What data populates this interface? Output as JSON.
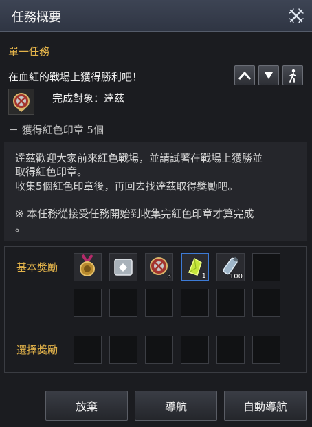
{
  "window": {
    "title": "任務概要"
  },
  "quest": {
    "type": "單一任務",
    "name": "在血紅的戰場上獲得勝利吧！",
    "target": "完成對象：達茲",
    "objective": "－ 獲得紅色印章 5個"
  },
  "description": {
    "lines": [
      "達茲歡迎大家前來紅色戰場，並請試著在戰場上獲勝並",
      "取得紅色印章。",
      "收集5個紅色印章後，再回去找達茲取得獎勵吧。",
      "",
      "※ 本任務從接受任務開始到收集完紅色印章才算完成",
      "。"
    ]
  },
  "rewards": {
    "basic_label": "基本獎勵",
    "choice_label": "選擇獎勵",
    "basic_items": [
      {
        "icon": "medal-icon",
        "qty": ""
      },
      {
        "icon": "scroll-icon",
        "qty": ""
      },
      {
        "icon": "red-seal-icon",
        "qty": "3"
      },
      {
        "icon": "crystal-icon",
        "qty": "1"
      },
      {
        "icon": "potion-icon",
        "qty": "100"
      }
    ]
  },
  "buttons": {
    "abandon": "放棄",
    "navigate": "導航",
    "auto_navigate": "自動導航"
  },
  "colors": {
    "accent": "#e3b34a",
    "titlebar": "#353b49"
  }
}
